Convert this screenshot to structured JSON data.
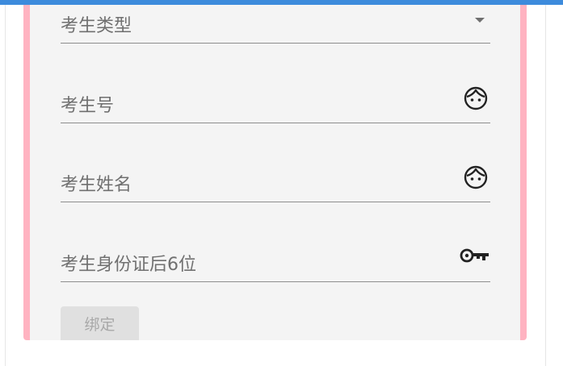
{
  "form": {
    "exam_type": {
      "placeholder": "考生类型",
      "icon": "dropdown-arrow-icon"
    },
    "exam_number": {
      "placeholder": "考生号",
      "icon": "face-icon"
    },
    "exam_name": {
      "placeholder": "考生姓名",
      "icon": "face-icon"
    },
    "id_card_last6": {
      "placeholder": "考生身份证后6位",
      "icon": "key-icon"
    },
    "bind_button_label": "绑定",
    "bind_button_enabled": false
  },
  "colors": {
    "top_bar": "#3d8bdc",
    "panel_border": "#ffb3c1",
    "panel_background": "#f4f4f4",
    "label_text": "#707070",
    "button_background": "#e0e0e0",
    "button_text": "#a8a8a8"
  }
}
